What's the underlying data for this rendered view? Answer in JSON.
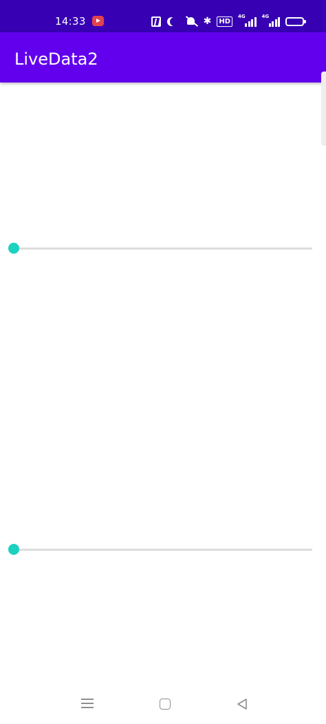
{
  "status_bar": {
    "time": "14:33",
    "icons": [
      "screen-record-icon",
      "nfc-icon",
      "do-not-disturb-moon-icon",
      "bell-muted-icon",
      "bluetooth-icon",
      "hd-icon",
      "signal-4g-icon",
      "signal-4g-icon",
      "battery-icon"
    ],
    "hd_label": "HD",
    "sim1_label": "4G",
    "sim2_label": "4G",
    "bluetooth_glyph": "✱"
  },
  "app_bar": {
    "title": "LiveData2"
  },
  "seekbars": [
    {
      "progress": 0
    },
    {
      "progress": 0
    }
  ],
  "colors": {
    "status_bar": "#3700b3",
    "app_bar": "#6200ee",
    "accent": "#03dac5",
    "track": "#dcdcdc",
    "background": "#ffffff"
  },
  "nav_bar": {
    "buttons": [
      "menu-icon",
      "home-icon",
      "back-icon"
    ]
  }
}
